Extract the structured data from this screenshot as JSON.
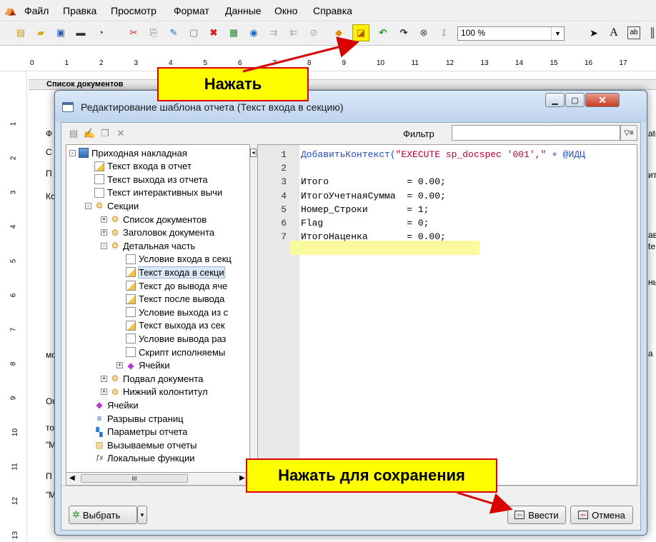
{
  "menu": [
    "Файл",
    "Правка",
    "Просмотр",
    "Формат",
    "Данные",
    "Окно",
    "Справка"
  ],
  "toolbar": {
    "zoom": "100 %"
  },
  "ruler": {
    "ticks": [
      "0",
      "1",
      "2",
      "3",
      "4",
      "5",
      "6",
      "7",
      "8",
      "9",
      "10",
      "11",
      "12",
      "13",
      "14",
      "15",
      "16",
      "17"
    ],
    "vticks": [
      "1",
      "2",
      "3",
      "4",
      "5",
      "6",
      "7",
      "8",
      "9",
      "10",
      "11",
      "12",
      "13"
    ]
  },
  "background": {
    "band_label": "Список документов",
    "fragments": [
      "Ф",
      "С",
      "П",
      "Ко",
      "Ог",
      "то",
      "\"М",
      "П",
      "\"М",
      "мо"
    ],
    "right_fragments": [
      "ato",
      "ит",
      "ав",
      "te",
      "нь",
      "а"
    ]
  },
  "dialog": {
    "title": "Редактирование шаблона отчета (Текст входа в секцию)",
    "filter_label": "Фильтр",
    "tree": [
      {
        "label": "Приходная накладная",
        "level": 0,
        "icon": "root",
        "exp": "-"
      },
      {
        "label": "Текст входа в отчет",
        "level": 1,
        "icon": "docy"
      },
      {
        "label": "Текст выхода из отчета",
        "level": 1,
        "icon": "doc"
      },
      {
        "label": "Текст интерактивных вычи",
        "level": 1,
        "icon": "doc"
      },
      {
        "label": "Секции",
        "level": 1,
        "icon": "sec",
        "exp": "-"
      },
      {
        "label": "Список документов",
        "level": 2,
        "icon": "sec",
        "exp": "+"
      },
      {
        "label": "Заголовок документа",
        "level": 2,
        "icon": "sec",
        "exp": "+"
      },
      {
        "label": "Детальная часть",
        "level": 2,
        "icon": "sec",
        "exp": "-"
      },
      {
        "label": "Условие входа в секц",
        "level": 3,
        "icon": "doc"
      },
      {
        "label": "Текст входа в секци",
        "level": 3,
        "icon": "docy",
        "selected": true
      },
      {
        "label": "Текст до вывода яче",
        "level": 3,
        "icon": "docy"
      },
      {
        "label": "Текст после вывода",
        "level": 3,
        "icon": "docy"
      },
      {
        "label": "Условие выхода из с",
        "level": 3,
        "icon": "doc"
      },
      {
        "label": "Текст выхода из сек",
        "level": 3,
        "icon": "docy"
      },
      {
        "label": "Условие вывода раз",
        "level": 3,
        "icon": "doc"
      },
      {
        "label": "Скрипт исполняемы",
        "level": 3,
        "icon": "doc"
      },
      {
        "label": "Ячейки",
        "level": 3,
        "icon": "cell",
        "exp": "+"
      },
      {
        "label": "Подвал документа",
        "level": 2,
        "icon": "sec",
        "exp": "+"
      },
      {
        "label": "Нижний колонтитул",
        "level": 2,
        "icon": "sec",
        "exp": "+"
      },
      {
        "label": "Ячейки",
        "level": 1,
        "icon": "cell"
      },
      {
        "label": "Разрывы страниц",
        "level": 1,
        "icon": "lines"
      },
      {
        "label": "Параметры отчета",
        "level": 1,
        "icon": "params"
      },
      {
        "label": "Вызываемые отчеты",
        "level": 1,
        "icon": "calls"
      },
      {
        "label": "Локальные функции",
        "level": 1,
        "icon": "fx"
      }
    ],
    "code": [
      {
        "n": "1",
        "text": "ДобавитьКонтекст(\"EXECUTE sp_docspec '001',\" + @ИДЦ"
      },
      {
        "n": "2",
        "text": ""
      },
      {
        "n": "3",
        "text": "Итого              = 0.00;"
      },
      {
        "n": "4",
        "text": "ИтогоУчетнаяСумма  = 0.00;"
      },
      {
        "n": "5",
        "text": "Номер_Строки       = 1;"
      },
      {
        "n": "6",
        "text": "Flag               = 0;"
      },
      {
        "n": "7",
        "text": "ИтогоНаценка       = 0.00;"
      }
    ],
    "select_button": "Выбрать",
    "enter_button": "Ввести",
    "cancel_button": "Отмена",
    "scroll_marker": "III"
  },
  "callouts": {
    "click": "Нажать",
    "save": "Нажать для сохранения"
  },
  "colors": {
    "callout_bg": "#ffff00",
    "callout_border": "#d80000",
    "keyword": "#1f4fb8",
    "string": "#b8003a",
    "highlight": "#fbf9a0"
  }
}
